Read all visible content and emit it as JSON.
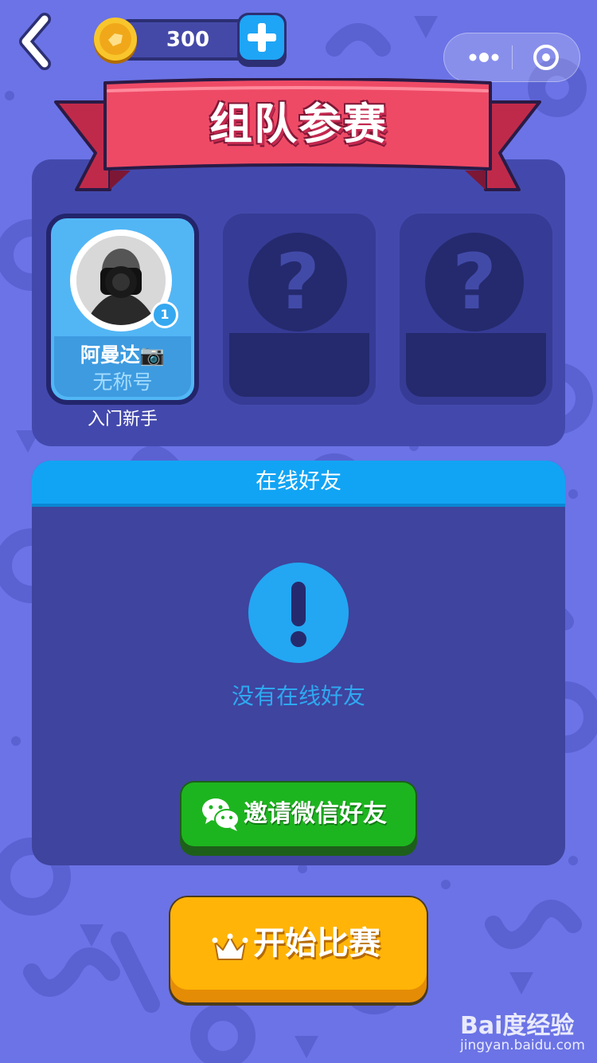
{
  "colors": {
    "background": "#6b73e6",
    "panel": "#4349ac",
    "ribbon": "#e8445f",
    "accent_blue": "#12a4f4",
    "invite_green": "#1db51f",
    "start_yellow": "#ffb407"
  },
  "topbar": {
    "back_icon": "chevron-left-icon",
    "coins": "300",
    "coin_icon": "coin-icon",
    "add_icon": "plus-icon",
    "menu_icons": [
      "more-dots-icon",
      "close-circle-icon"
    ]
  },
  "banner": {
    "title": "组队参赛"
  },
  "team": {
    "me": {
      "nickname": "阿曼达📷",
      "title": "无称号",
      "level": "1",
      "rank": "入门新手"
    },
    "empty_slots": [
      {
        "placeholder": "?"
      },
      {
        "placeholder": "?"
      }
    ]
  },
  "friends": {
    "header": "在线好友",
    "alert_icon": "exclamation-icon",
    "empty_text": "没有在线好友",
    "invite_label": "邀请微信好友",
    "invite_icon": "wechat-icon"
  },
  "start": {
    "label": "开始比赛",
    "icon": "crown-icon"
  },
  "watermark": {
    "brand": "Bai度经验",
    "url": "jingyan.baidu.com"
  }
}
